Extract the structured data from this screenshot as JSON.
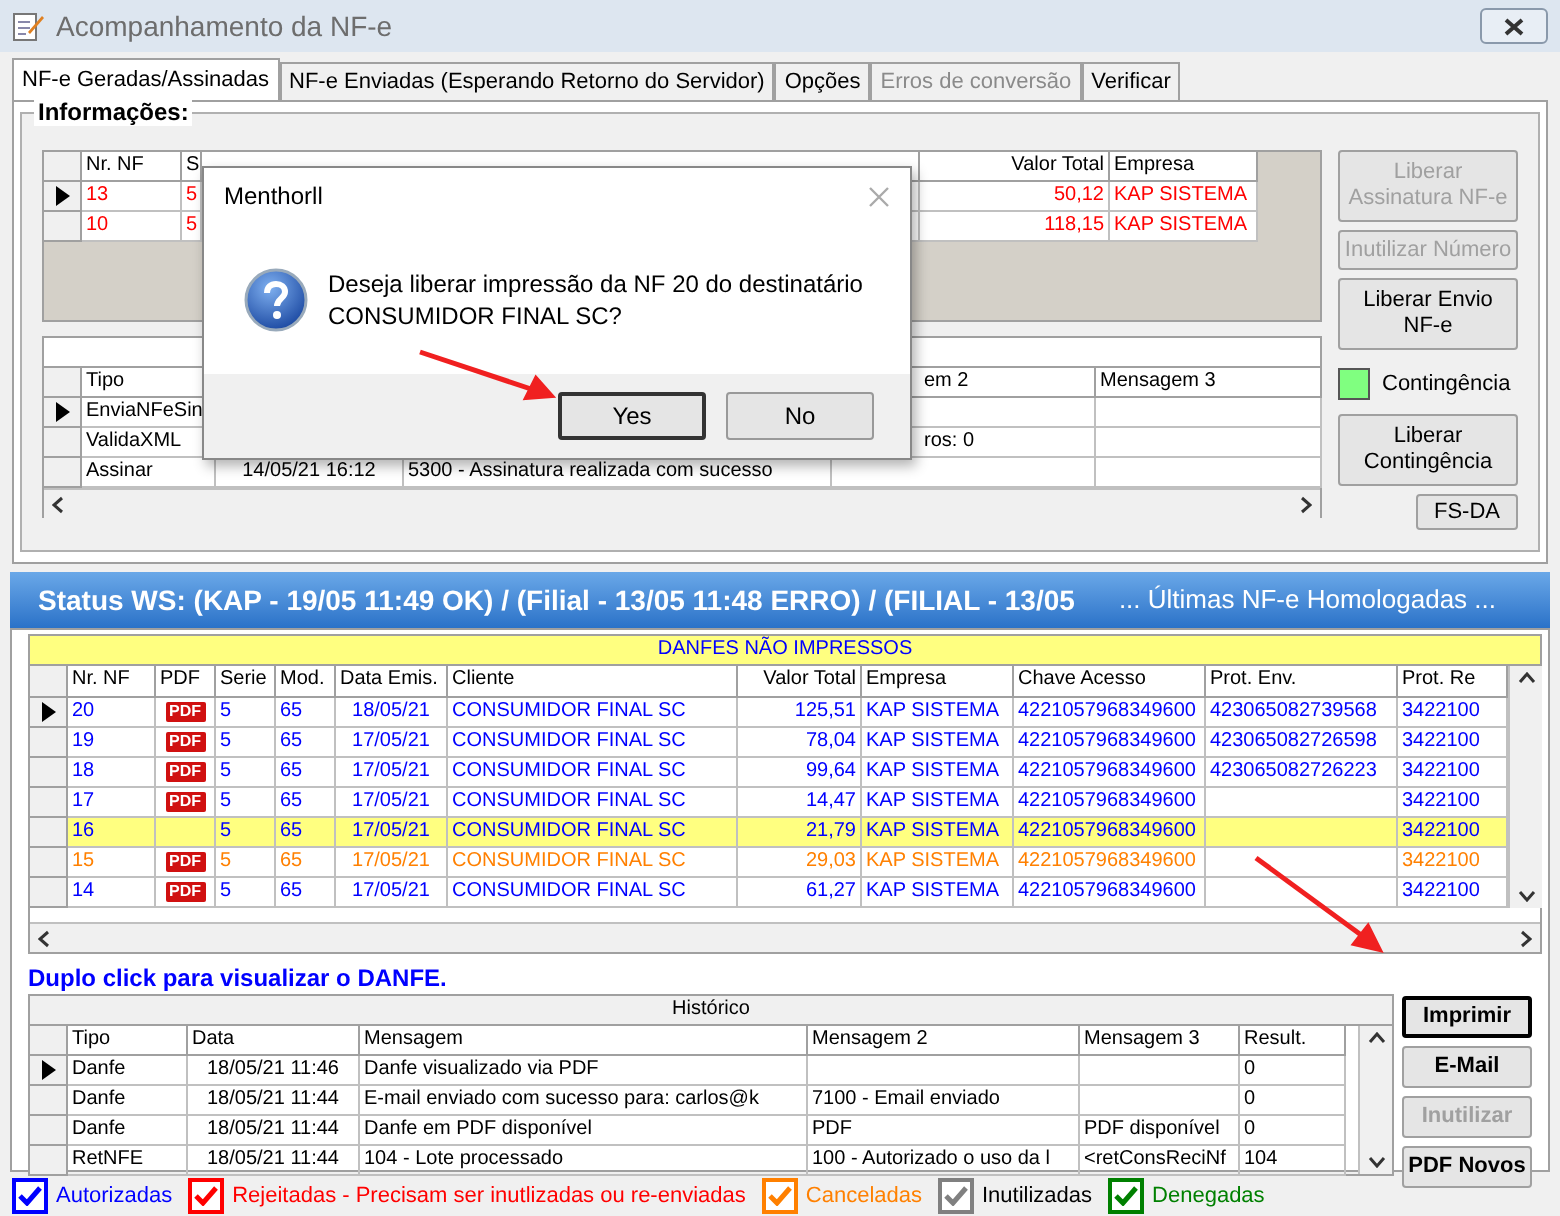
{
  "window": {
    "title": "Acompanhamento da NF-e"
  },
  "tabs": [
    {
      "label": "NF-e Geradas/Assinadas",
      "selected": true,
      "disabled": false
    },
    {
      "label": "NF-e Enviadas (Esperando Retorno do Servidor)",
      "selected": false,
      "disabled": false
    },
    {
      "label": "Opções",
      "selected": false,
      "disabled": false
    },
    {
      "label": "Erros de conversão",
      "selected": false,
      "disabled": true
    },
    {
      "label": "Verificar",
      "selected": false,
      "disabled": false
    }
  ],
  "info": {
    "title": "Informações:",
    "grid": {
      "columns": [
        "Nr. NF",
        "S",
        "Valor Total",
        "Empresa"
      ],
      "rows": [
        {
          "selected": true,
          "cells": [
            "13",
            "5",
            "50,12",
            "KAP SISTEMA"
          ]
        },
        {
          "selected": false,
          "cells": [
            "10",
            "5",
            "118,15",
            "KAP SISTEMA"
          ]
        }
      ]
    },
    "log": {
      "columns": [
        "Tipo",
        "",
        "",
        "em 2",
        "Mensagem 3"
      ],
      "rows": [
        {
          "selected": true,
          "cells": [
            "EnviaNFeSin",
            "",
            "",
            "",
            ""
          ]
        },
        {
          "selected": false,
          "cells": [
            "ValidaXML",
            "",
            "",
            "ros: 0",
            ""
          ]
        },
        {
          "selected": false,
          "cells": [
            "Assinar",
            "14/05/21 16:12",
            "5300 - Assinatura realizada com sucesso",
            "",
            ""
          ]
        }
      ]
    },
    "buttons": [
      {
        "label": "Liberar Assinatura NF-e",
        "disabled": true
      },
      {
        "label": "Inutilizar Número",
        "disabled": true
      },
      {
        "label": "Liberar Envio NF-e",
        "disabled": false
      }
    ],
    "contingency": {
      "label": "Contingência",
      "color": "#80ff80"
    },
    "buttons2": [
      {
        "label": "Liberar Contingência",
        "disabled": false
      }
    ],
    "fsda": "FS-DA"
  },
  "dialog": {
    "title": "Menthorll",
    "message": "Deseja liberar impressão da NF 20 do destinatário CONSUMIDOR FINAL SC?",
    "buttons": [
      {
        "label": "Yes",
        "focused": true
      },
      {
        "label": "No",
        "focused": false
      }
    ]
  },
  "status_bar": {
    "text": "Status WS: (KAP - 19/05 11:49 OK) / (Filial - 13/05 11:48 ERRO) / (FILIAL - 13/05",
    "extra": "... Últimas NF-e Homologadas ..."
  },
  "danfes": {
    "title": "DANFES NÃO IMPRESSOS",
    "columns": [
      "Nr. NF",
      "PDF",
      "Serie",
      "Mod.",
      "Data Emis.",
      "Cliente",
      "Valor Total",
      "Empresa",
      "Chave Acesso",
      "Prot. Env.",
      "Prot. Re"
    ],
    "rows": [
      {
        "selected": true,
        "kind": "authorized",
        "cells": [
          "20",
          "PDF",
          "5",
          "65",
          "18/05/21",
          "CONSUMIDOR FINAL SC",
          "125,51",
          "KAP SISTEMA",
          "4221057968349600",
          "423065082739568",
          "3422100"
        ]
      },
      {
        "selected": false,
        "kind": "authorized",
        "cells": [
          "19",
          "PDF",
          "5",
          "65",
          "17/05/21",
          "CONSUMIDOR FINAL SC",
          "78,04",
          "KAP SISTEMA",
          "4221057968349600",
          "423065082726598",
          "3422100"
        ]
      },
      {
        "selected": false,
        "kind": "authorized",
        "cells": [
          "18",
          "PDF",
          "5",
          "65",
          "17/05/21",
          "CONSUMIDOR FINAL SC",
          "99,64",
          "KAP SISTEMA",
          "4221057968349600",
          "423065082726223",
          "3422100"
        ]
      },
      {
        "selected": false,
        "kind": "authorized",
        "cells": [
          "17",
          "PDF",
          "5",
          "65",
          "17/05/21",
          "CONSUMIDOR FINAL SC",
          "14,47",
          "KAP SISTEMA",
          "4221057968349600",
          "",
          "3422100"
        ]
      },
      {
        "selected": false,
        "kind": "pending",
        "cells": [
          "16",
          "",
          "5",
          "65",
          "17/05/21",
          "CONSUMIDOR FINAL SC",
          "21,79",
          "KAP SISTEMA",
          "4221057968349600",
          "",
          "3422100"
        ]
      },
      {
        "selected": false,
        "kind": "cancelled",
        "cells": [
          "15",
          "PDF",
          "5",
          "65",
          "17/05/21",
          "CONSUMIDOR FINAL SC",
          "29,03",
          "KAP SISTEMA",
          "4221057968349600",
          "",
          "3422100"
        ]
      },
      {
        "selected": false,
        "kind": "authorized",
        "cells": [
          "14",
          "PDF",
          "5",
          "65",
          "17/05/21",
          "CONSUMIDOR FINAL SC",
          "61,27",
          "KAP SISTEMA",
          "4221057968349600",
          "",
          "3422100"
        ]
      }
    ]
  },
  "hint": "Duplo click para visualizar o DANFE.",
  "history": {
    "title": "Histórico",
    "columns": [
      "Tipo",
      "Data",
      "Mensagem",
      "Mensagem 2",
      "Mensagem 3",
      "Result."
    ],
    "rows": [
      {
        "selected": true,
        "cells": [
          "Danfe",
          "18/05/21 11:46",
          "Danfe visualizado via PDF",
          "",
          "",
          "0"
        ]
      },
      {
        "selected": false,
        "cells": [
          "Danfe",
          "18/05/21 11:44",
          "E-mail enviado com sucesso para: carlos@k",
          "7100 - Email enviado",
          "",
          "0"
        ]
      },
      {
        "selected": false,
        "cells": [
          "Danfe",
          "18/05/21 11:44",
          "Danfe em PDF disponível",
          "PDF",
          "PDF disponível",
          "0"
        ]
      },
      {
        "selected": false,
        "cells": [
          "RetNFE",
          "18/05/21 11:44",
          "104 - Lote processado",
          "100 - Autorizado o uso da l",
          "<retConsReciNf",
          "104"
        ]
      }
    ]
  },
  "actions": [
    {
      "label": "Imprimir",
      "disabled": false,
      "focused": true
    },
    {
      "label": "E-Mail",
      "disabled": false,
      "focused": false
    },
    {
      "label": "Inutilizar",
      "disabled": true,
      "focused": false
    },
    {
      "label": "PDF Novos",
      "disabled": false,
      "focused": false
    }
  ],
  "legend": [
    {
      "label": "Autorizadas",
      "checked": true,
      "color": "#0000ff"
    },
    {
      "label": "Rejeitadas - Precisam ser inutlizadas ou re-enviadas",
      "checked": true,
      "color": "#ff0000"
    },
    {
      "label": "Canceladas",
      "checked": true,
      "color": "#ff8000"
    },
    {
      "label": "Inutilizadas",
      "checked": true,
      "color": "#808080"
    },
    {
      "label": "Denegadas",
      "checked": true,
      "color": "#008000"
    }
  ]
}
